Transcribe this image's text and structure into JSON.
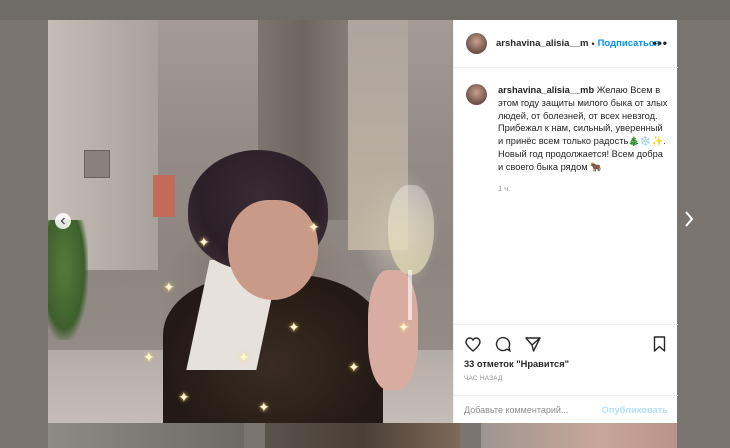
{
  "post": {
    "username": "arshavina_alisia__mb",
    "header_username": "arshavina_alisia__m",
    "follow_label": "Подписаться",
    "more_label": "•••",
    "caption_text": "Желаю Всем в этом году защиты милого быка от злых людей, от болезней, от всех невзгод. Прибежал к нам, сильный, уверенный и принёс всем только радость🎄❄️✨. Новый год продолжается! Всем добра и своего быка рядом 🐂",
    "caption_time": "1 ч.",
    "likes": "33 отметок \"Нравится\"",
    "posted_ago": "ЧАС НАЗАД",
    "comment_placeholder": "Добавьте комментарий...",
    "publish_label": "Опубликовать"
  },
  "icons": {
    "like": "heart-icon",
    "comment": "comment-icon",
    "share": "share-icon",
    "save": "bookmark-icon",
    "prev": "chevron-left-icon",
    "next": "chevron-right-icon"
  },
  "colors": {
    "accent": "#0095f6",
    "publish_disabled": "#b2dffc",
    "muted": "#8e8e8e",
    "text": "#262626"
  }
}
